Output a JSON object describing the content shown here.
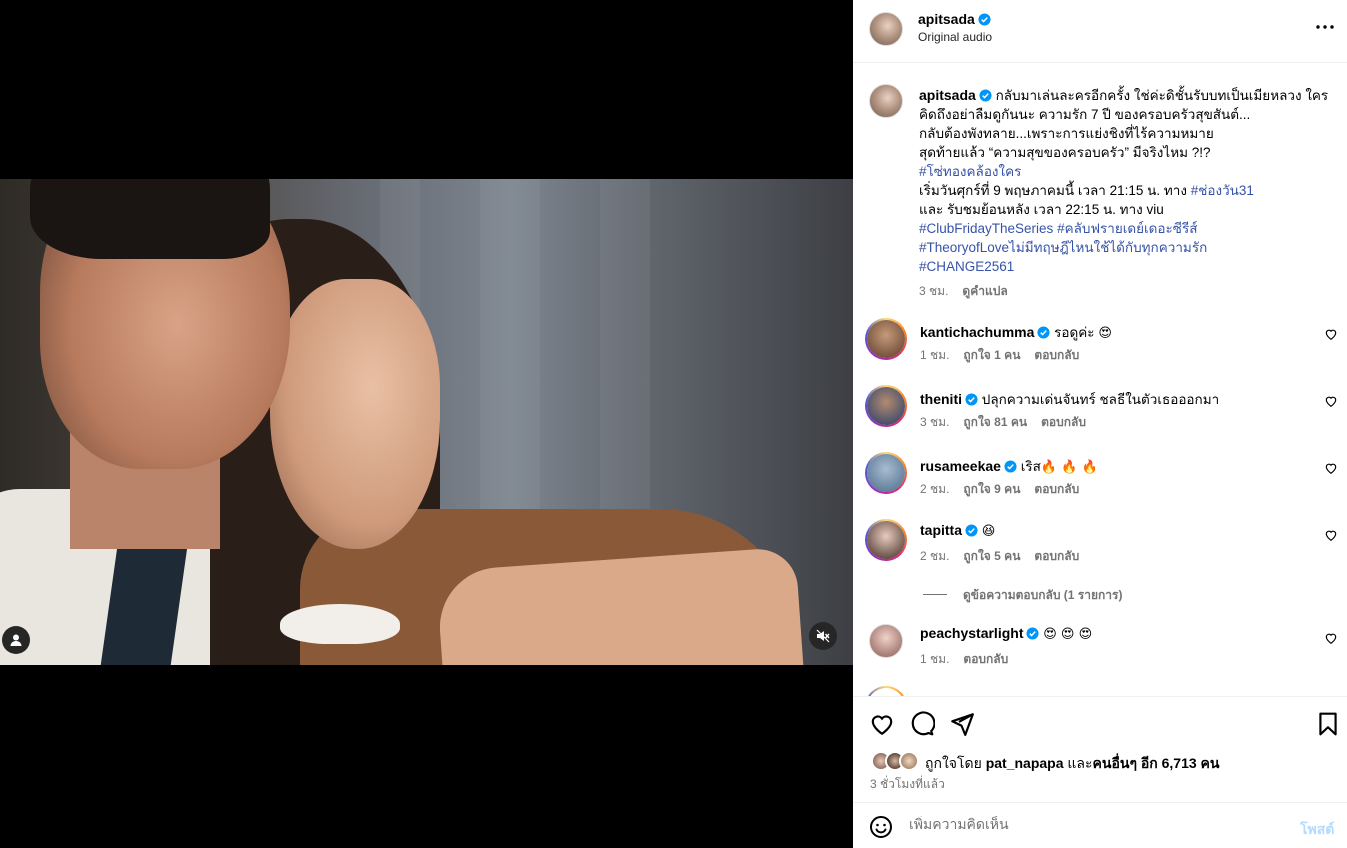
{
  "header": {
    "username": "apitsada",
    "subtitle": "Original audio",
    "more_icon": "more-horizontal-icon"
  },
  "caption": {
    "username": "apitsada",
    "lines": [
      "กลับมาเล่นละครอีกครั้ง ใช่ค่ะดิชั้นรับบทเป็นเมียหลวง ใคร",
      "คิดถึงอย่าลืมดูกันนะ ความรัก 7 ปี ของครอบครัวสุขสันต์...",
      "กลับต้องพังทลาย...เพราะการแย่งชิงที่ไร้ความหมาย",
      "สุดท้ายแล้ว “ความสุขของครอบครัว” มีจริงไหม ?!?"
    ],
    "hashtag1": "#โซ่ทองคล้องใคร",
    "line_schedule_prefix": "เริ่มวันศุกร์ที่ 9 พฤษภาคมนี้ เวลา 21:15 น. ทาง ",
    "hashtag_channel": "#ช่องวัน31",
    "line_replay": "และ รับชมย้อนหลัง เวลา 22:15 น. ทาง viu",
    "hashtag_club": "#ClubFridayTheSeries",
    "hashtag_club_th": "#คลับฟรายเดย์เดอะซีรีส์",
    "hashtag_theory": "#TheoryofLoveไม่มีทฤษฎีไหนใช้ได้กับทุกความรัก",
    "hashtag_change": "#CHANGE2561",
    "time": "3 ชม.",
    "translate": "ดูคำแปล"
  },
  "comments": [
    {
      "username": "kantichachumma",
      "text": "รอดูค่ะ ",
      "emoji": "😍",
      "time": "1 ชม.",
      "likes": "ถูกใจ 1 คน",
      "reply": "ตอบกลับ"
    },
    {
      "username": "theniti",
      "text": "ปลุกความเด่นจันทร์ ชลธีในตัวเธอออกมา",
      "emoji": "",
      "time": "3 ชม.",
      "likes": "ถูกใจ 81 คน",
      "reply": "ตอบกลับ"
    },
    {
      "username": "rusameekae",
      "text": "เริส",
      "emoji": "🔥 🔥 🔥",
      "time": "2 ชม.",
      "likes": "ถูกใจ 9 คน",
      "reply": "ตอบกลับ"
    },
    {
      "username": "tapitta",
      "text": "",
      "emoji": "😆",
      "time": "2 ชม.",
      "likes": "ถูกใจ 5 คน",
      "reply": "ตอบกลับ"
    },
    {
      "username": "peachystarlight",
      "text": "",
      "emoji": "😍 😍 😍",
      "time": "1 ชม.",
      "likes": "",
      "reply": "ตอบกลับ"
    }
  ],
  "view_replies": "ดูข้อความตอบกลับ (1 รายการ)",
  "actions": {
    "icons": [
      "heart-icon",
      "comment-icon",
      "share-icon",
      "bookmark-icon"
    ]
  },
  "likes": {
    "prefix": "ถูกใจโดย ",
    "user": "pat_napapa",
    "middle": " และ",
    "others": "คนอื่นๆ อีก 6,713 คน"
  },
  "posted": "3 ชั่วโมงที่แล้ว",
  "add_comment": {
    "placeholder": "เพิ่มความคิดเห็น",
    "post_label": "โพสต์"
  },
  "colors": {
    "link": "#3653a8",
    "verified": "#0095f6",
    "muted": "#737373",
    "post_disabled": "#b3dbff"
  }
}
